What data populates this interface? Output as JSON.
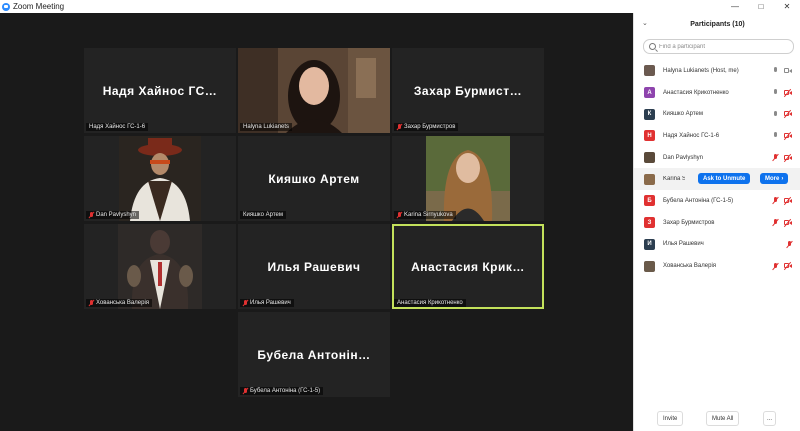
{
  "window": {
    "title": "Zoom Meeting",
    "controls": [
      "—",
      "□",
      "✕"
    ]
  },
  "tiles": [
    {
      "display_name": "Надя Хайнос ГС…",
      "label": "Надя Хайнос ГС-1-6",
      "muted": false
    },
    {
      "display_name": "",
      "label": "Halyna Lukianets",
      "muted": false
    },
    {
      "display_name": "Захар Бурмист…",
      "label": "Захар Бурмистров",
      "muted": true
    },
    {
      "display_name": "",
      "label": "Dan Pavlyshyn",
      "muted": true
    },
    {
      "display_name": "Кияшко Артем",
      "label": "Кияшко Артем",
      "muted": false
    },
    {
      "display_name": "",
      "label": "Karina Sirnyukova",
      "muted": true
    },
    {
      "display_name": "",
      "label": "Хованська Валерія",
      "muted": true
    },
    {
      "display_name": "Илья Рашевич",
      "label": "Илья Рашевич",
      "muted": true
    },
    {
      "display_name": "Анастасия Крик…",
      "label": "Анастасия Крикотненко",
      "muted": false
    },
    {
      "display_name": "Бубела Антонін…",
      "label": "Бубела Антоніна (ГС-1-5)",
      "muted": true
    }
  ],
  "panel": {
    "title": "Participants (10)",
    "search_placeholder": "Find a participant",
    "participants": [
      {
        "initial": "",
        "name": "Halyna Lukianets (Host, me)",
        "avatar_color": "#6b5a50",
        "mic_muted": false,
        "cam_off": false
      },
      {
        "initial": "А",
        "name": "Анастасия Крикотненко",
        "avatar_color": "#8e44ad",
        "mic_muted": false,
        "cam_off": true
      },
      {
        "initial": "К",
        "name": "Кияшко Артем",
        "avatar_color": "#2c3e50",
        "mic_muted": false,
        "cam_off": true
      },
      {
        "initial": "Н",
        "name": "Надя Хайнос ГС-1-6",
        "avatar_color": "#e03131",
        "mic_muted": false,
        "cam_off": true
      },
      {
        "initial": "",
        "name": "Dan Pavlyshyn",
        "avatar_color": "#5a4a3a",
        "mic_muted": true,
        "cam_off": true
      },
      {
        "initial": "",
        "name": "Karina Sirnyukova",
        "avatar_color": "#8a6a4a",
        "mic_muted": true,
        "cam_off": false
      },
      {
        "initial": "Б",
        "name": "Бубела Антоніна (ГС-1-5)",
        "avatar_color": "#e03131",
        "mic_muted": true,
        "cam_off": true
      },
      {
        "initial": "З",
        "name": "Захар Бурмистров",
        "avatar_color": "#e03131",
        "mic_muted": true,
        "cam_off": true
      },
      {
        "initial": "И",
        "name": "Илья Рашевич",
        "avatar_color": "#2c3e50",
        "mic_muted": true,
        "cam_off": false
      },
      {
        "initial": "",
        "name": "Хованська Валерія",
        "avatar_color": "#6a5a4a",
        "mic_muted": true,
        "cam_off": true
      }
    ],
    "hover_actions": {
      "unmute": "Ask to Unmute",
      "more": "More"
    },
    "footer": {
      "invite": "Invite",
      "mute_all": "Mute All",
      "more": "..."
    }
  },
  "colors": {
    "accent": "#0e72ed",
    "active_speaker": "#c3e15b",
    "muted": "#e03131"
  }
}
